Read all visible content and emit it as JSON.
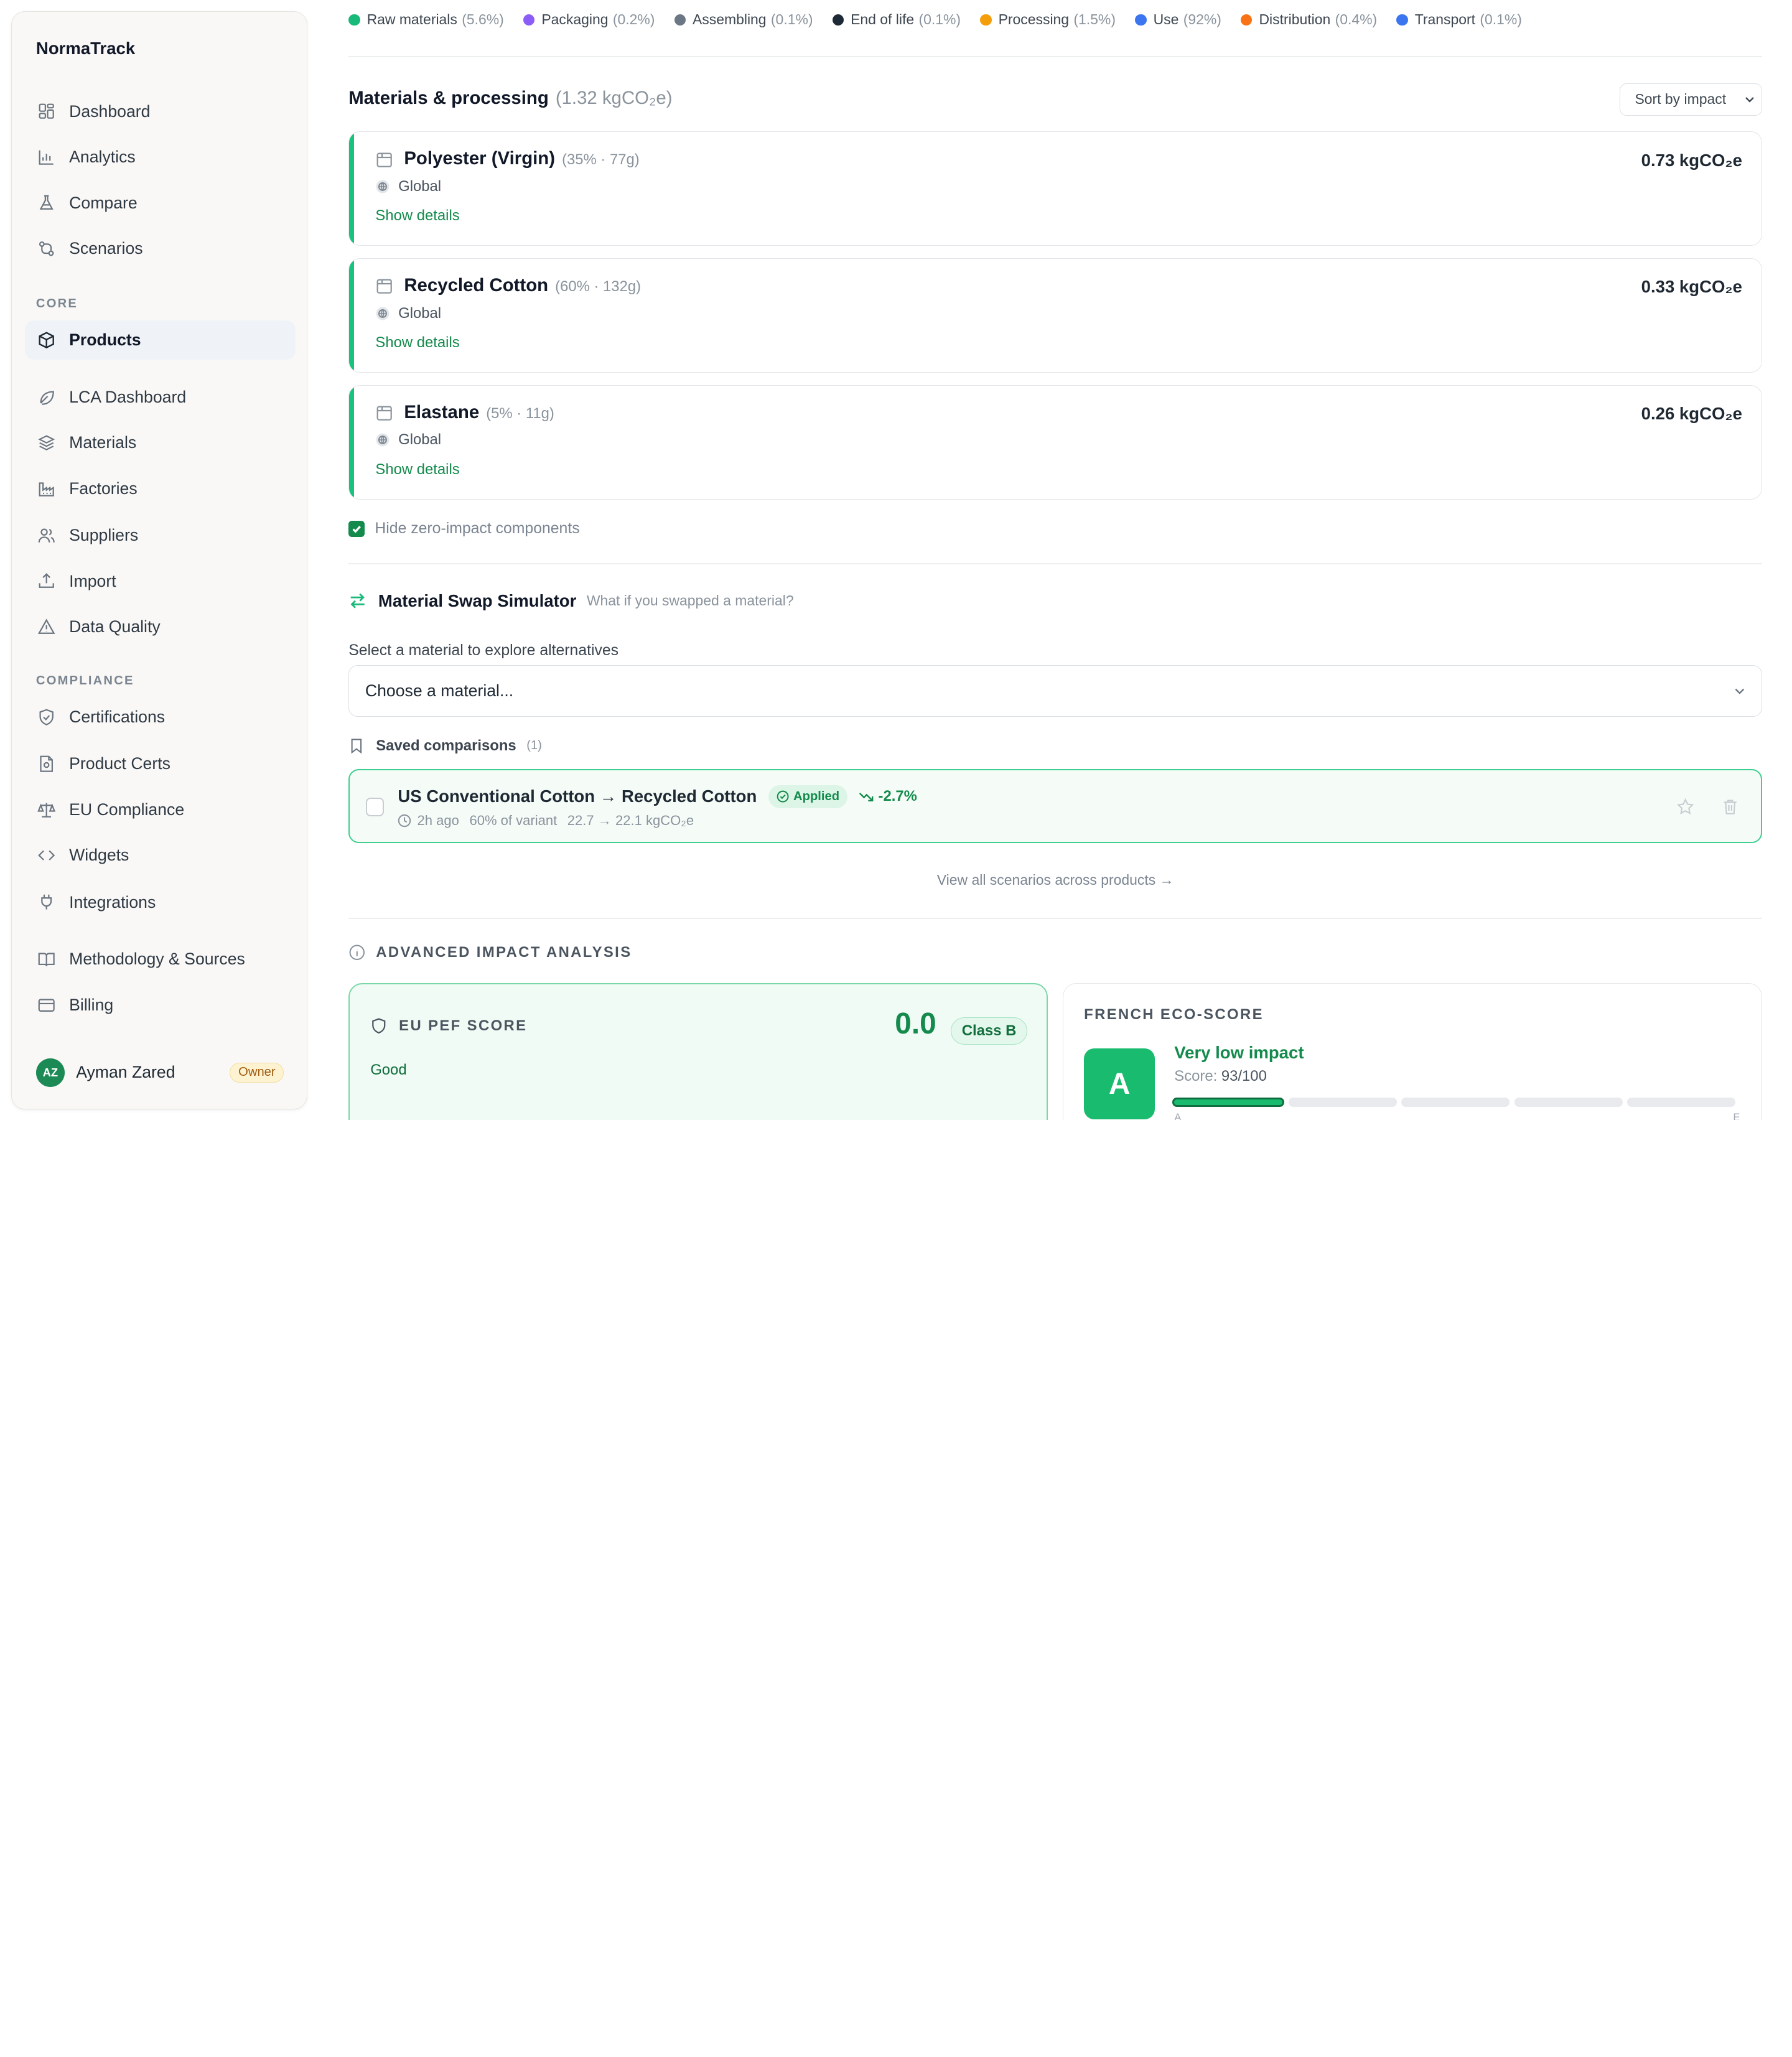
{
  "app": {
    "name": "NormaTrack"
  },
  "sidebar": {
    "main_items": [
      {
        "label": "Dashboard",
        "icon": "dashboard-icon"
      },
      {
        "label": "Analytics",
        "icon": "bar-chart-icon"
      },
      {
        "label": "Compare",
        "icon": "flask-icon"
      },
      {
        "label": "Scenarios",
        "icon": "branch-icon"
      }
    ],
    "core_title": "CORE",
    "core_items": [
      {
        "label": "Products",
        "icon": "box-icon",
        "active": true
      },
      {
        "label": "LCA Dashboard",
        "icon": "leaf-icon"
      },
      {
        "label": "Materials",
        "icon": "layers-icon"
      },
      {
        "label": "Factories",
        "icon": "factory-icon"
      },
      {
        "label": "Suppliers",
        "icon": "users-icon"
      },
      {
        "label": "Import",
        "icon": "upload-icon"
      },
      {
        "label": "Data Quality",
        "icon": "warning-icon"
      }
    ],
    "compliance_title": "COMPLIANCE",
    "compliance_items": [
      {
        "label": "Certifications",
        "icon": "shield-icon"
      },
      {
        "label": "Product Certs",
        "icon": "document-icon"
      },
      {
        "label": "EU Compliance",
        "icon": "scale-icon"
      },
      {
        "label": "Widgets",
        "icon": "code-icon"
      },
      {
        "label": "Integrations",
        "icon": "plug-icon"
      },
      {
        "label": "Methodology & Sources",
        "icon": "book-icon"
      },
      {
        "label": "Billing",
        "icon": "card-icon"
      }
    ],
    "user": {
      "initials": "AZ",
      "name": "Ayman Zared",
      "role": "Owner"
    }
  },
  "legend": [
    {
      "label": "Raw materials",
      "pct": "(5.6%)",
      "color": "#19b97a"
    },
    {
      "label": "Packaging",
      "pct": "(0.2%)",
      "color": "#8b5cf6"
    },
    {
      "label": "Assembling",
      "pct": "(0.1%)",
      "color": "#6b7785"
    },
    {
      "label": "End of life",
      "pct": "(0.1%)",
      "color": "#1e2937"
    },
    {
      "label": "Processing",
      "pct": "(1.5%)",
      "color": "#f59e0b"
    },
    {
      "label": "Use",
      "pct": "(92%)",
      "color": "#3b76f0"
    },
    {
      "label": "Distribution",
      "pct": "(0.4%)",
      "color": "#f97316"
    },
    {
      "label": "Transport",
      "pct": "(0.1%)",
      "color": "#3b76f0"
    }
  ],
  "materials": {
    "title": "Materials & processing",
    "total": "(1.32 kgCO₂e)",
    "sort_label": "Sort by impact",
    "items": [
      {
        "name": "Polyester (Virgin)",
        "meta": "(35% · 77g)",
        "origin": "Global",
        "details": "Show details",
        "value": "0.73 kgCO₂e"
      },
      {
        "name": "Recycled Cotton",
        "meta": "(60% · 132g)",
        "origin": "Global",
        "details": "Show details",
        "value": "0.33 kgCO₂e"
      },
      {
        "name": "Elastane",
        "meta": "(5% · 11g)",
        "origin": "Global",
        "details": "Show details",
        "value": "0.26 kgCO₂e"
      }
    ],
    "hide_zero_label": "Hide zero-impact components",
    "hide_zero_checked": true
  },
  "swap": {
    "title": "Material Swap Simulator",
    "subtitle": "What if you swapped a material?",
    "select_label": "Select a material to explore alternatives",
    "select_value": "Choose a material...",
    "saved_label": "Saved comparisons",
    "saved_count": "(1)",
    "comparison": {
      "title": "US Conventional Cotton → Recycled Cotton",
      "status": "Applied",
      "delta": "-2.7%",
      "time": "2h ago",
      "share": "60% of variant",
      "change": "22.7 → 22.1 kgCO₂e"
    },
    "view_all": "View all scenarios across products →"
  },
  "advanced": {
    "title": "ADVANCED IMPACT ANALYSIS",
    "pef": {
      "label": "EU PEF SCORE",
      "score": "0.0",
      "class": "Class B",
      "rating": "Good"
    },
    "eco": {
      "label": "FRENCH ECO-SCORE",
      "grade": "A",
      "impact": "Very low impact",
      "score_prefix": "Score: ",
      "score": "93/100",
      "score_value": 93,
      "range_start": "A",
      "range_end": "E"
    }
  }
}
